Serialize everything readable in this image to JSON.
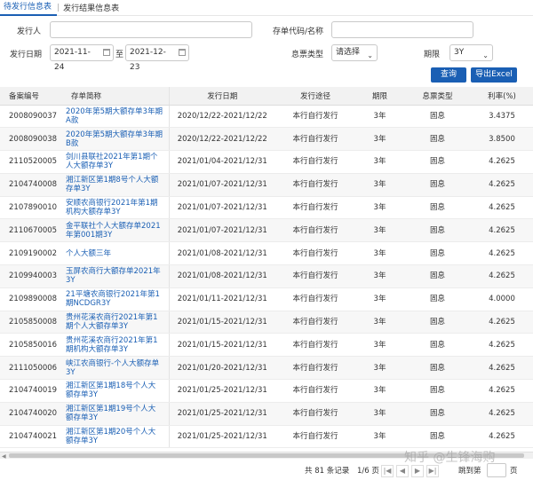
{
  "tabs": [
    "待发行信息表",
    "发行结果信息表"
  ],
  "tab_separator": "|",
  "form": {
    "issuer_label": "发行人",
    "issuer_value": "",
    "code_label": "存单代码/名称",
    "code_value": "",
    "date_label": "发行日期",
    "date_start": "2021-11-24",
    "date_to": "至",
    "date_end": "2021-12-23",
    "rate_type_label": "息票类型",
    "rate_type_value": "请选择",
    "term_label": "期限",
    "term_value": "3Y"
  },
  "buttons": {
    "query": "查询",
    "export": "导出Excel"
  },
  "table": {
    "headers": [
      "备案编号",
      "存单简称",
      "发行日期",
      "发行途径",
      "期限",
      "息票类型",
      "利率(%)"
    ],
    "rows": [
      [
        "2008090037",
        "2020年第5期大额存单3年期A款",
        "2020/12/22-2021/12/22",
        "本行自行发行",
        "3年",
        "固息",
        "3.4375"
      ],
      [
        "2008090038",
        "2020年第5期大额存单3年期B款",
        "2020/12/22-2021/12/22",
        "本行自行发行",
        "3年",
        "固息",
        "3.8500"
      ],
      [
        "2110520005",
        "剑川县联社2021年第1期个人大额存单3Y",
        "2021/01/04-2021/12/31",
        "本行自行发行",
        "3年",
        "固息",
        "4.2625"
      ],
      [
        "2104740008",
        "湘江新区第1期8号个人大额存单3Y",
        "2021/01/07-2021/12/31",
        "本行自行发行",
        "3年",
        "固息",
        "4.2625"
      ],
      [
        "2107890010",
        "安顺农商银行2021年第1期机构大额存单3Y",
        "2021/01/07-2021/12/31",
        "本行自行发行",
        "3年",
        "固息",
        "4.2625"
      ],
      [
        "2110670005",
        "金平联社个人大额存单2021年第001期3Y",
        "2021/01/07-2021/12/31",
        "本行自行发行",
        "3年",
        "固息",
        "4.2625"
      ],
      [
        "2109190002",
        "个人大额三年",
        "2021/01/08-2021/12/31",
        "本行自行发行",
        "3年",
        "固息",
        "4.2625"
      ],
      [
        "2109940003",
        "玉屏农商行大额存单2021年3Y",
        "2021/01/08-2021/12/31",
        "本行自行发行",
        "3年",
        "固息",
        "4.2625"
      ],
      [
        "2109890008",
        "21平塘农商银行2021年第1期NCDGR3Y",
        "2021/01/11-2021/12/31",
        "本行自行发行",
        "3年",
        "固息",
        "4.0000"
      ],
      [
        "2105850008",
        "贵州花溪农商行2021年第1期个人大额存单3Y",
        "2021/01/15-2021/12/31",
        "本行自行发行",
        "3年",
        "固息",
        "4.2625"
      ],
      [
        "2105850016",
        "贵州花溪农商行2021年第1期机构大额存单3Y",
        "2021/01/15-2021/12/31",
        "本行自行发行",
        "3年",
        "固息",
        "4.2625"
      ],
      [
        "2111050006",
        "峡江农商银行-个人大额存单3Y",
        "2021/01/20-2021/12/31",
        "本行自行发行",
        "3年",
        "固息",
        "4.2625"
      ],
      [
        "2104740019",
        "湘江新区第1期18号个人大额存单3Y",
        "2021/01/25-2021/12/31",
        "本行自行发行",
        "3年",
        "固息",
        "4.2625"
      ],
      [
        "2104740020",
        "湘江新区第1期19号个人大额存单3Y",
        "2021/01/25-2021/12/31",
        "本行自行发行",
        "3年",
        "固息",
        "4.2625"
      ],
      [
        "2104740021",
        "湘江新区第1期20号个人大额存单3Y",
        "2021/01/25-2021/12/31",
        "本行自行发行",
        "3年",
        "固息",
        "4.2625"
      ]
    ]
  },
  "pager": {
    "total_text": "共 81 条记录",
    "page_text": "1/6 页",
    "first": "|◀",
    "prev": "◀",
    "next": "▶",
    "last": "▶|",
    "jump_label": "跳到第",
    "jump_suffix": "页"
  },
  "watermark": "知乎 @生锋海购",
  "colors": {
    "accent": "#1a5fb4",
    "header_bg": "#f2f2f2",
    "stripe": "#f7f7f7"
  }
}
